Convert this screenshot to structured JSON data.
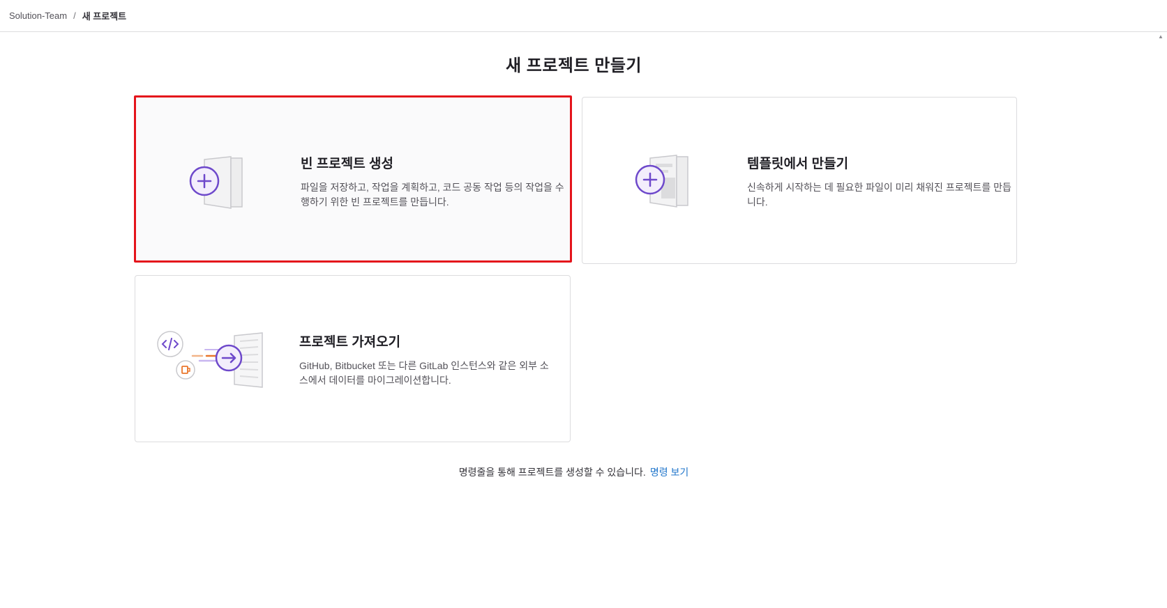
{
  "breadcrumb": {
    "parent": "Solution-Team",
    "separator": "/",
    "current": "새 프로젝트"
  },
  "page_title": "새 프로젝트 만들기",
  "cards": {
    "blank": {
      "title": "빈 프로젝트 생성",
      "description": "파일을 저장하고, 작업을 계획하고, 코드 공동 작업 등의 작업을 수행하기 위한 빈 프로젝트를 만듭니다.",
      "icon": "blank-project-illustration"
    },
    "template": {
      "title": "템플릿에서 만들기",
      "description": "신속하게 시작하는 데 필요한 파일이 미리 채워진 프로젝트를 만듭니다.",
      "icon": "template-project-illustration"
    },
    "import": {
      "title": "프로젝트 가져오기",
      "description": "GitHub, Bitbucket 또는 다른 GitLab 인스턴스와 같은 외부 소스에서 데이터를 마이그레이션합니다.",
      "icon": "import-project-illustration"
    }
  },
  "cli_hint": {
    "text": "명령줄을 통해 프로젝트를 생성할 수 있습니다.",
    "link": "명령 보기"
  },
  "colors": {
    "accent": "#6e49cb",
    "highlight_border": "#e4141b",
    "link": "#1f75cb",
    "orange": "#e9762b"
  }
}
